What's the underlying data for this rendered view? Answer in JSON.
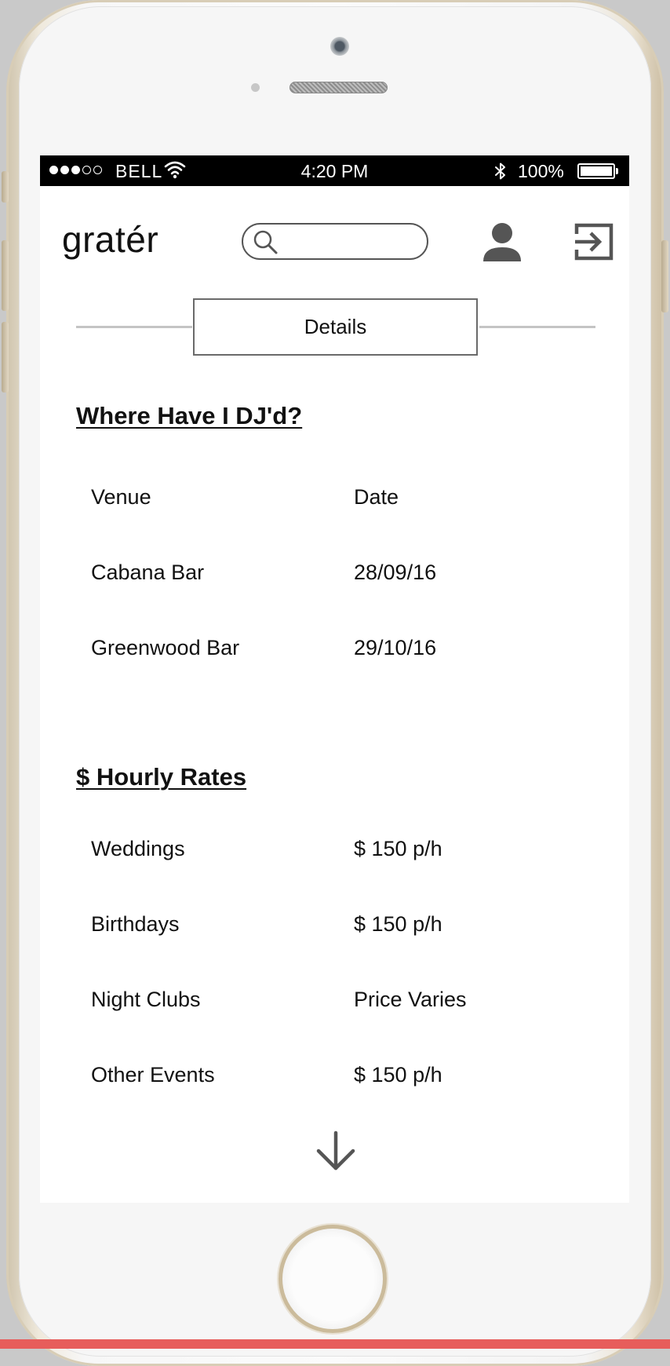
{
  "status_bar": {
    "carrier": "BELL",
    "time": "4:20 PM",
    "battery": "100%"
  },
  "header": {
    "logo": "gratér",
    "search_placeholder": ""
  },
  "tab": {
    "label": "Details"
  },
  "venues": {
    "title": "Where Have I DJ'd?",
    "header": {
      "venue": "Venue",
      "date": "Date"
    },
    "rows": [
      {
        "venue": "Cabana Bar",
        "date": "28/09/16"
      },
      {
        "venue": "Greenwood Bar",
        "date": "29/10/16"
      }
    ]
  },
  "rates": {
    "title": "$ Hourly Rates",
    "rows": [
      {
        "event": "Weddings",
        "price": "$ 150 p/h"
      },
      {
        "event": "Birthdays",
        "price": "$ 150 p/h"
      },
      {
        "event": "Night Clubs",
        "price": "Price Varies"
      },
      {
        "event": "Other Events",
        "price": "$ 150 p/h"
      }
    ]
  },
  "colors": {
    "status_bar_bg": "#000000",
    "screen_bg": "#ffffff",
    "icon_gray": "#555555",
    "bottom_strip": "#e75d5b"
  },
  "icons": [
    "search-icon",
    "user-icon",
    "logout-icon",
    "arrow-down-icon",
    "wifi-icon",
    "bluetooth-icon",
    "battery-icon"
  ]
}
